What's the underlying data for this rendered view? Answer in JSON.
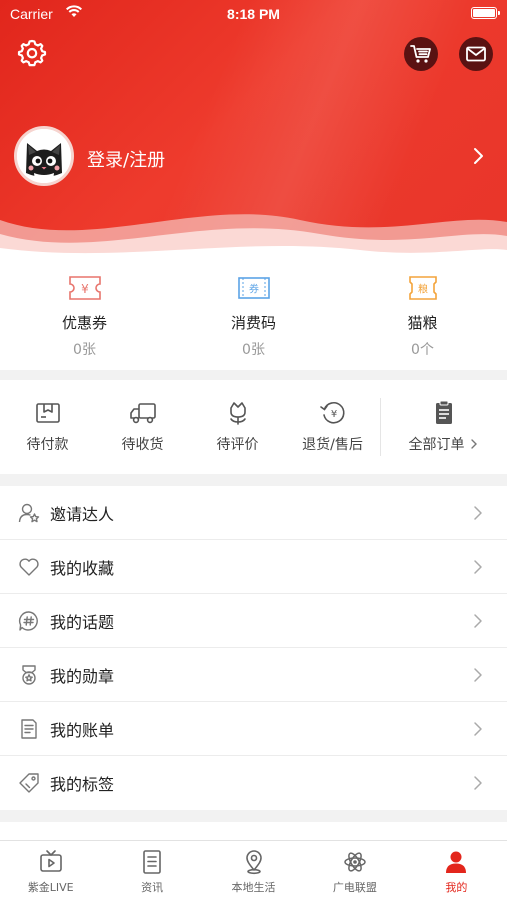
{
  "status_bar": {
    "carrier": "Carrier",
    "time": "8:18 PM"
  },
  "header": {
    "login_label": "登录/注册",
    "icons": {
      "settings": "gear-icon",
      "cart": "cart-icon",
      "mail": "mail-icon",
      "arrow": "chevron-right-icon"
    }
  },
  "coupons": [
    {
      "label": "优惠券",
      "count": "0张",
      "glyph": "¥",
      "color": "#e8746c",
      "icon": "coupon-icon"
    },
    {
      "label": "消费码",
      "count": "0张",
      "glyph": "券",
      "color": "#5ba3e6",
      "icon": "voucher-icon"
    },
    {
      "label": "猫粮",
      "count": "0个",
      "glyph": "粮",
      "color": "#f3a43b",
      "icon": "cat-food-icon"
    }
  ],
  "orders": {
    "items": [
      {
        "label": "待付款",
        "icon": "wallet-icon"
      },
      {
        "label": "待收货",
        "icon": "truck-icon"
      },
      {
        "label": "待评价",
        "icon": "flower-icon"
      },
      {
        "label": "退货/售后",
        "icon": "refund-icon"
      }
    ],
    "all_label": "全部订单"
  },
  "menu": [
    {
      "label": "邀请达人",
      "icon": "invite-user-icon"
    },
    {
      "label": "我的收藏",
      "icon": "heart-icon"
    },
    {
      "label": "我的话题",
      "icon": "hashtag-icon"
    },
    {
      "label": "我的勋章",
      "icon": "medal-icon"
    },
    {
      "label": "我的账单",
      "icon": "bill-icon"
    },
    {
      "label": "我的标签",
      "icon": "tag-icon"
    }
  ],
  "tabbar": [
    {
      "label": "紫金LIVE",
      "icon": "tv-icon",
      "active": false
    },
    {
      "label": "资讯",
      "icon": "news-icon",
      "active": false
    },
    {
      "label": "本地生活",
      "icon": "location-icon",
      "active": false
    },
    {
      "label": "广电联盟",
      "icon": "atom-icon",
      "active": false
    },
    {
      "label": "我的",
      "icon": "user-icon",
      "active": true
    }
  ],
  "colors": {
    "brand": "#e3261c",
    "accent_dark": "#5a1212"
  }
}
